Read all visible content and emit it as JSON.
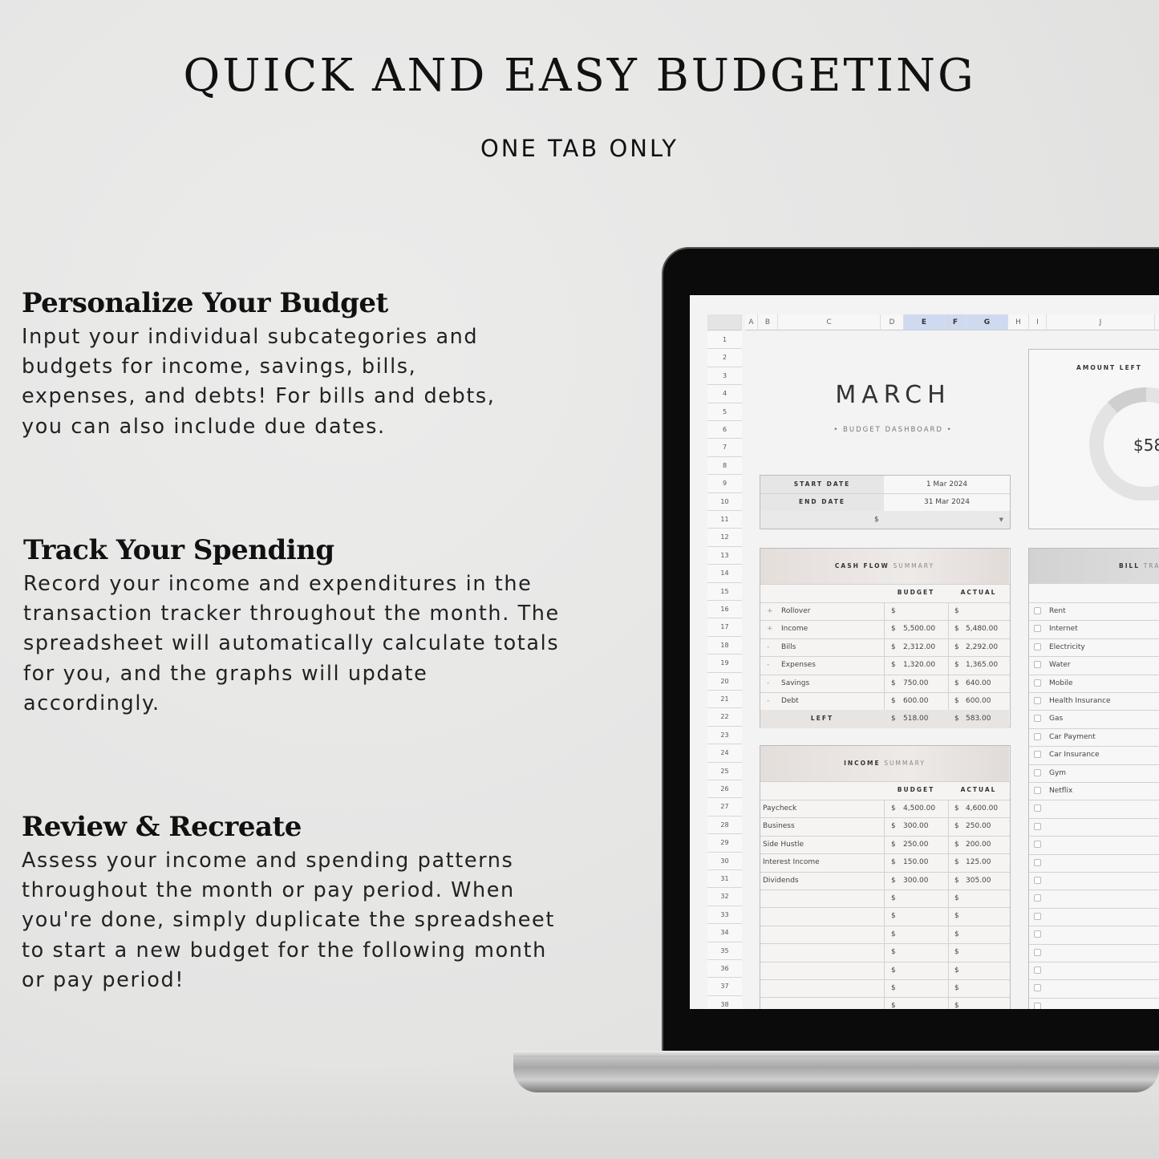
{
  "title": "QUICK AND EASY BUDGETING",
  "subtitle": "ONE TAB ONLY",
  "sections": [
    {
      "heading": "Personalize Your Budget",
      "body": "Input your individual subcategories and budgets for income, savings, bills, expenses, and debts! For bills and debts, you can also include due dates."
    },
    {
      "heading": "Track Your Spending",
      "body": "Record your income and expenditures in the transaction tracker throughout the month. The spreadsheet will automatically calculate totals for you, and the graphs will update accordingly."
    },
    {
      "heading": "Review & Recreate",
      "body": "Assess your income and spending patterns throughout the month or pay period. When you're done, simply duplicate the spreadsheet to start a new budget for the following month or pay period!"
    }
  ],
  "sheet": {
    "columns": [
      "A",
      "B",
      "C",
      "D",
      "E",
      "F",
      "G",
      "H",
      "I",
      "J"
    ],
    "selected_columns": [
      "E",
      "F",
      "G"
    ],
    "row_count": 38,
    "month": "MARCH",
    "dashboard_label": "• BUDGET DASHBOARD •",
    "start_label": "START DATE",
    "start_value": "1 Mar 2024",
    "end_label": "END DATE",
    "end_value": "31 Mar 2024",
    "currency": "$",
    "amount_left_label": "AMOUNT LEFT",
    "amount_left_value": "$58",
    "cash_flow": {
      "title_bold": "CASH FLOW",
      "title_light": "SUMMARY",
      "budget_label": "BUDGET",
      "actual_label": "ACTUAL",
      "rows": [
        {
          "sign": "+",
          "label": "Rollover",
          "budget": "",
          "actual": ""
        },
        {
          "sign": "+",
          "label": "Income",
          "budget": "5,500.00",
          "actual": "5,480.00"
        },
        {
          "sign": "-",
          "label": "Bills",
          "budget": "2,312.00",
          "actual": "2,292.00"
        },
        {
          "sign": "-",
          "label": "Expenses",
          "budget": "1,320.00",
          "actual": "1,365.00"
        },
        {
          "sign": "-",
          "label": "Savings",
          "budget": "750.00",
          "actual": "640.00"
        },
        {
          "sign": "-",
          "label": "Debt",
          "budget": "600.00",
          "actual": "600.00"
        }
      ],
      "left_label": "LEFT",
      "left_budget": "518.00",
      "left_actual": "583.00"
    },
    "income": {
      "title_bold": "INCOME",
      "title_light": "SUMMARY",
      "budget_label": "BUDGET",
      "actual_label": "ACTUAL",
      "rows": [
        {
          "label": "Paycheck",
          "budget": "4,500.00",
          "actual": "4,600.00"
        },
        {
          "label": "Business",
          "budget": "300.00",
          "actual": "250.00"
        },
        {
          "label": "Side Hustle",
          "budget": "250.00",
          "actual": "200.00"
        },
        {
          "label": "Interest Income",
          "budget": "150.00",
          "actual": "125.00"
        },
        {
          "label": "Dividends",
          "budget": "300.00",
          "actual": "305.00"
        },
        {
          "label": "",
          "budget": "",
          "actual": ""
        },
        {
          "label": "",
          "budget": "",
          "actual": ""
        },
        {
          "label": "",
          "budget": "",
          "actual": ""
        },
        {
          "label": "",
          "budget": "",
          "actual": ""
        },
        {
          "label": "",
          "budget": "",
          "actual": ""
        },
        {
          "label": "",
          "budget": "",
          "actual": ""
        },
        {
          "label": "",
          "budget": "",
          "actual": ""
        }
      ]
    },
    "bills": {
      "title_bold": "BILL",
      "title_light": "TRA",
      "items": [
        "Rent",
        "Internet",
        "Electricity",
        "Water",
        "Mobile",
        "Health Insurance",
        "Gas",
        "Car Payment",
        "Car Insurance",
        "Gym",
        "Netflix",
        "",
        "",
        "",
        "",
        "",
        "",
        "",
        "",
        "",
        "",
        "",
        ""
      ]
    }
  }
}
